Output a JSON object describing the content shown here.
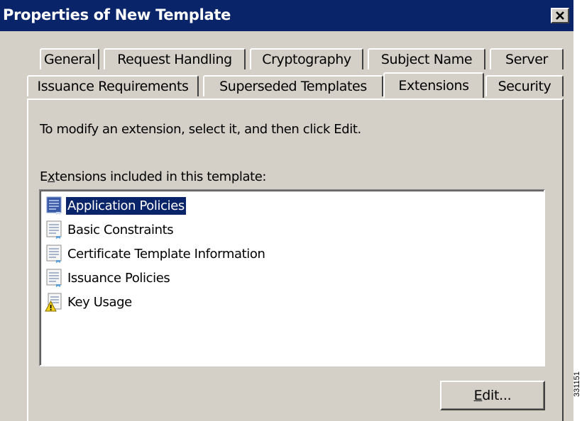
{
  "window": {
    "title": "Properties of New Template",
    "close_icon": "close-icon"
  },
  "tabs": {
    "row_back": [
      "General",
      "Request Handling",
      "Cryptography",
      "Subject Name",
      "Server"
    ],
    "row_front": [
      "Issuance Requirements",
      "Superseded Templates",
      "Extensions",
      "Security"
    ],
    "active": "Extensions"
  },
  "content": {
    "instruction": "To modify an extension, select it, and then click Edit.",
    "list_label_prefix": "E",
    "list_label_accel": "x",
    "list_label_rest": "tensions included in this template:",
    "extensions": [
      {
        "label": "Application Policies",
        "icon": "extension-icon",
        "selected": true
      },
      {
        "label": "Basic Constraints",
        "icon": "extension-icon",
        "selected": false
      },
      {
        "label": "Certificate Template Information",
        "icon": "extension-icon",
        "selected": false
      },
      {
        "label": "Issuance Policies",
        "icon": "extension-icon",
        "selected": false
      },
      {
        "label": "Key Usage",
        "icon": "warning-extension-icon",
        "selected": false
      }
    ],
    "edit_button_accel": "E",
    "edit_button_rest": "dit..."
  },
  "figure_id": "331151",
  "colors": {
    "titlebar": "#0a246a",
    "face": "#d4d0c8",
    "selection": "#0a246a"
  }
}
